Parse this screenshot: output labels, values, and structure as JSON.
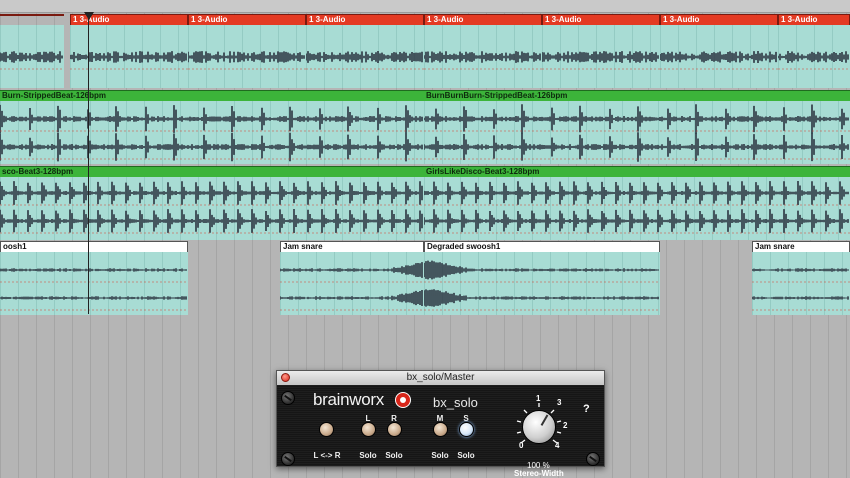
{
  "tracks": [
    {
      "name": "audio-track",
      "regions": [
        {
          "label": "",
          "from": 0,
          "to": 64
        },
        {
          "label": "1 3-Audio",
          "from": 70,
          "to": 188
        },
        {
          "label": "1 3-Audio",
          "from": 188,
          "to": 306
        },
        {
          "label": "1 3-Audio",
          "from": 306,
          "to": 424
        },
        {
          "label": "1 3-Audio",
          "from": 424,
          "to": 542
        },
        {
          "label": "1 3-Audio",
          "from": 542,
          "to": 660
        },
        {
          "label": "1 3-Audio",
          "from": 660,
          "to": 778
        },
        {
          "label": "1 3-Audio",
          "from": 778,
          "to": 850
        }
      ]
    },
    {
      "name": "beat-track",
      "regions": [
        {
          "label": "Burn-StrippedBeat-126bpm",
          "from": 0,
          "to": 424
        },
        {
          "label": "BurnBurnBurn-StrippedBeat-126bpm",
          "from": 424,
          "to": 850
        }
      ]
    },
    {
      "name": "disco-track",
      "regions": [
        {
          "label": "sco-Beat3-128bpm",
          "from": 0,
          "to": 424
        },
        {
          "label": "GirlsLikeDisco-Beat3-128bpm",
          "from": 424,
          "to": 850
        }
      ]
    },
    {
      "name": "fx-track",
      "regions": [
        {
          "label": "oosh1",
          "from": 0,
          "to": 188
        },
        {
          "label": "Jam snare",
          "from": 280,
          "to": 424
        },
        {
          "label": "Degraded swoosh1",
          "from": 424,
          "to": 660
        },
        {
          "label": "Jam snare",
          "from": 752,
          "to": 850
        }
      ]
    }
  ],
  "plugin": {
    "title": "bx_solo/Master",
    "brand": "brainworx",
    "product": "bx_solo",
    "help": "?",
    "buttons": [
      {
        "id": "lr-swap",
        "l1": "",
        "l2": "L <-> R",
        "active": false
      },
      {
        "id": "l-solo",
        "l1": "L",
        "l2": "Solo",
        "active": false
      },
      {
        "id": "r-solo",
        "l1": "R",
        "l2": "Solo",
        "active": false
      },
      {
        "id": "m-solo",
        "l1": "M",
        "l2": "Solo",
        "active": false
      },
      {
        "id": "s-solo",
        "l1": "S",
        "l2": "Solo",
        "active": true
      }
    ],
    "knob": {
      "value": "100 %",
      "name": "Stereo-Width",
      "ticks": [
        "0",
        "1",
        "2",
        "3",
        "4"
      ]
    }
  },
  "colors": {
    "audio_region": "#e43a23",
    "beat_region": "#3cb43a",
    "fx_region": "#ffffff",
    "waveform": "#2b3440"
  }
}
